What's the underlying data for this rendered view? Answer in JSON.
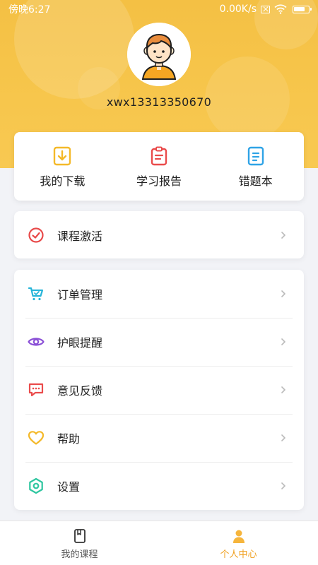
{
  "status_bar": {
    "time": "傍晚6:27",
    "network_speed": "0.00K/s",
    "icons": [
      "sim-icon",
      "wifi-icon",
      "battery-icon"
    ]
  },
  "profile": {
    "username": "xwx13313350670",
    "avatar_icon": "boy-avatar"
  },
  "quick_actions": [
    {
      "label": "我的下载",
      "icon": "download-icon",
      "color": "#f4b92a"
    },
    {
      "label": "学习报告",
      "icon": "report-icon",
      "color": "#ea4b4b"
    },
    {
      "label": "错题本",
      "icon": "notebook-icon",
      "color": "#2fa3e6"
    }
  ],
  "activate": {
    "label": "课程激活",
    "icon": "check-circle-icon",
    "color": "#e84a4a"
  },
  "menu": [
    {
      "label": "订单管理",
      "icon": "cart-icon",
      "color": "#27b5d9"
    },
    {
      "label": "护眼提醒",
      "icon": "eye-icon",
      "color": "#8a4fd6"
    },
    {
      "label": "意见反馈",
      "icon": "chat-icon",
      "color": "#ea4b4b"
    },
    {
      "label": "帮助",
      "icon": "heart-icon",
      "color": "#f4b92a"
    },
    {
      "label": "设置",
      "icon": "settings-icon",
      "color": "#2fc6a0"
    }
  ],
  "bottom_nav": [
    {
      "label": "我的课程",
      "icon": "book-icon",
      "active": false
    },
    {
      "label": "个人中心",
      "icon": "user-icon",
      "active": true
    }
  ],
  "colors": {
    "header": "#f6c247",
    "background": "#f2f3f7"
  }
}
